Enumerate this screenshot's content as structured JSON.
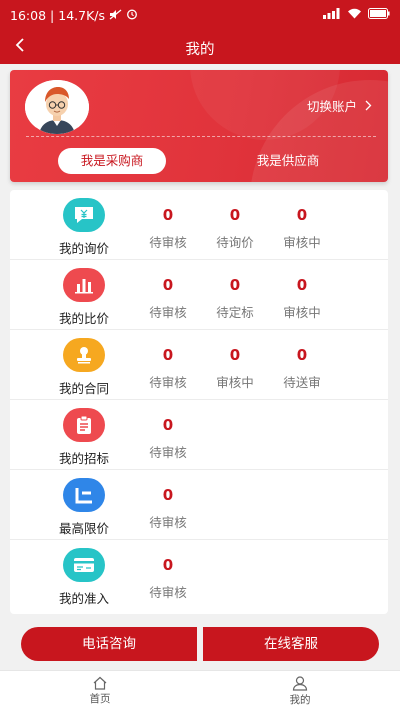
{
  "status_bar": {
    "time": "16:08",
    "speed": "14.7K/s"
  },
  "app_bar": {
    "title": "我的",
    "back_icon": "chevron-left-icon"
  },
  "user_card": {
    "switch_account": "切换账户",
    "role_buyer": "我是采购商",
    "role_supplier": "我是供应商"
  },
  "rows": [
    {
      "label": "我的询价",
      "icon": "chat-yen-icon",
      "color": "#27c4c7",
      "stats": [
        {
          "num": "0",
          "txt": "待审核"
        },
        {
          "num": "0",
          "txt": "待询价"
        },
        {
          "num": "0",
          "txt": "审核中"
        }
      ]
    },
    {
      "label": "我的比价",
      "icon": "bar-chart-icon",
      "color": "#ee4a4f",
      "stats": [
        {
          "num": "0",
          "txt": "待审核"
        },
        {
          "num": "0",
          "txt": "待定标"
        },
        {
          "num": "0",
          "txt": "审核中"
        }
      ]
    },
    {
      "label": "我的合同",
      "icon": "stamp-icon",
      "color": "#f6a820",
      "stats": [
        {
          "num": "0",
          "txt": "待审核"
        },
        {
          "num": "0",
          "txt": "审核中"
        },
        {
          "num": "0",
          "txt": "待送审"
        }
      ]
    },
    {
      "label": "我的招标",
      "icon": "clipboard-icon",
      "color": "#ee4a4f",
      "stats": [
        {
          "num": "0",
          "txt": "待审核"
        }
      ]
    },
    {
      "label": "最高限价",
      "icon": "price-limit-icon",
      "color": "#2f86e8",
      "stats": [
        {
          "num": "0",
          "txt": "待审核"
        }
      ]
    },
    {
      "label": "我的准入",
      "icon": "card-icon",
      "color": "#27c4c7",
      "stats": [
        {
          "num": "0",
          "txt": "待审核"
        }
      ]
    }
  ],
  "buttons": {
    "phone": "电话咨询",
    "online": "在线客服"
  },
  "tabs": {
    "home": "首页",
    "mine": "我的"
  },
  "colors": {
    "brand_red": "#c8161e",
    "card_red": "#e93c42"
  }
}
